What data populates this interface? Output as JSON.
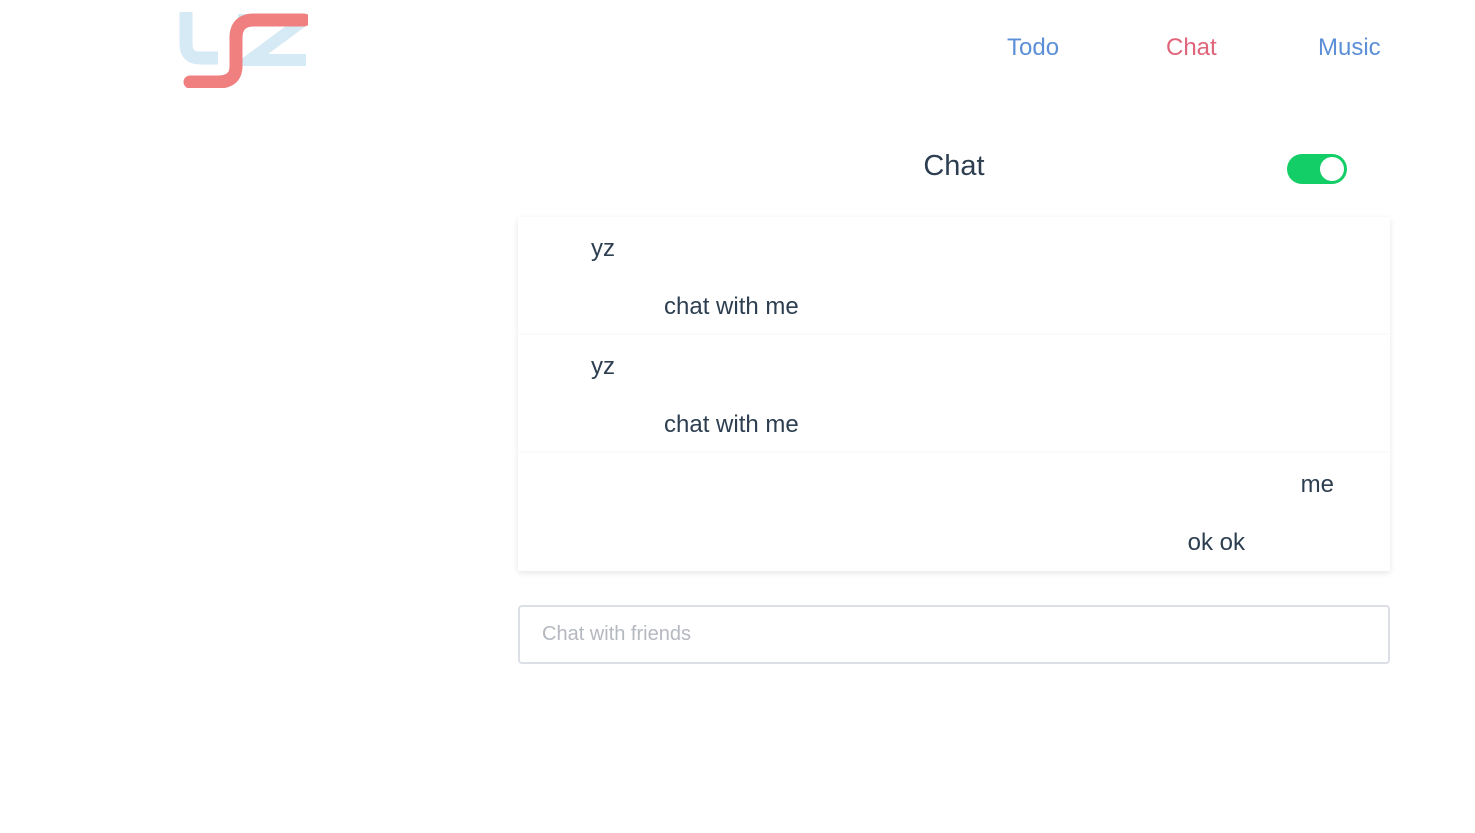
{
  "header": {
    "logo_text": "yz",
    "nav": [
      {
        "label": "Todo",
        "color": "#5c8fd6"
      },
      {
        "label": "Chat",
        "color": "#e0647a"
      },
      {
        "label": "Music",
        "color": "#5c8fd6"
      }
    ]
  },
  "chat": {
    "title": "Chat",
    "toggle": {
      "on": true,
      "color": "#13ce66"
    },
    "messages": [
      {
        "sender": "yz",
        "text": "chat with me",
        "side": "left"
      },
      {
        "sender": "yz",
        "text": "chat with me",
        "side": "left"
      },
      {
        "sender": "me",
        "text": "ok ok",
        "side": "right"
      }
    ],
    "input": {
      "placeholder": "Chat with friends",
      "value": ""
    }
  },
  "colors": {
    "logo_y": "#d5eaf5",
    "logo_z": "#d5eaf5",
    "logo_swoosh": "#f08080"
  }
}
